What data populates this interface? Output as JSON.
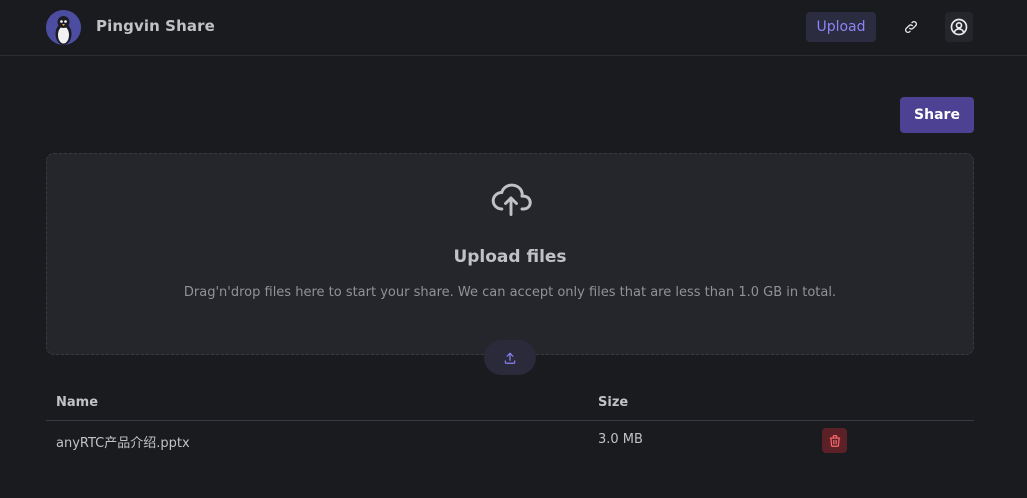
{
  "app": {
    "title": "Pingvin Share"
  },
  "nav": {
    "upload_label": "Upload",
    "link_icon": "link-icon",
    "account_icon": "user-circle-icon"
  },
  "actions": {
    "share_label": "Share"
  },
  "dropzone": {
    "title": "Upload files",
    "description": "Drag'n'drop files here to start your share. We can accept only files that are less than 1.0 GB in total.",
    "icon": "cloud-upload-icon"
  },
  "files_table": {
    "columns": [
      "Name",
      "Size"
    ],
    "rows": [
      {
        "name": "anyRTC产品介绍.pptx",
        "size": "3.0 MB"
      }
    ]
  },
  "colors": {
    "background": "#1a1b1e",
    "accent": "#8b84f6",
    "share_button": "#4c4192",
    "danger": "#e03131"
  }
}
